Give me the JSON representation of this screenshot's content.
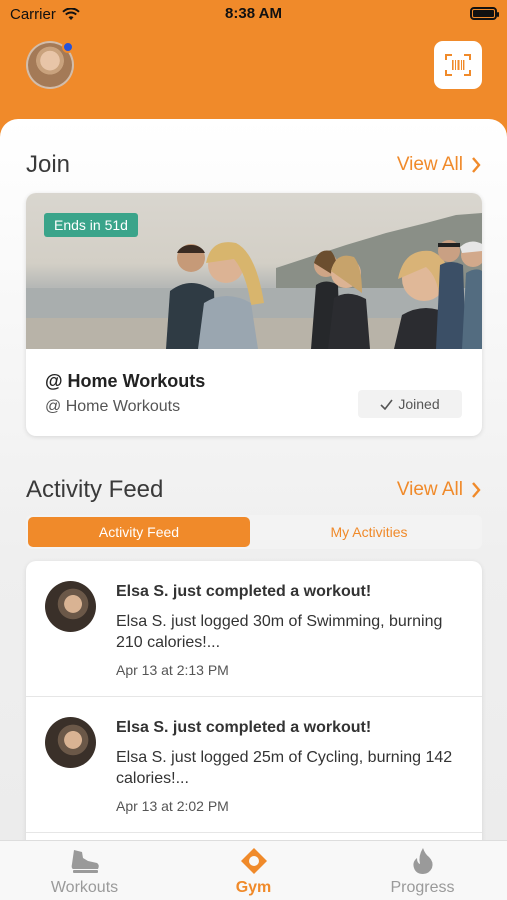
{
  "status_bar": {
    "carrier": "Carrier",
    "time": "8:38 AM"
  },
  "header": {
    "avatar_icon": "profile-avatar",
    "scan_icon": "barcode-scan-icon"
  },
  "join": {
    "title": "Join",
    "view_all": "View All",
    "card": {
      "badge": "Ends in 51d",
      "name": "@ Home Workouts",
      "subtitle": "@ Home Workouts",
      "joined_label": "Joined"
    }
  },
  "activity": {
    "title": "Activity Feed",
    "view_all": "View All",
    "tabs": [
      {
        "label": "Activity Feed",
        "active": true
      },
      {
        "label": "My Activities",
        "active": false
      }
    ],
    "items": [
      {
        "title": "Elsa S. just completed a workout!",
        "text": "Elsa S. just logged 30m of Swimming, burning 210 calories!...",
        "time": "Apr 13 at 2:13 PM"
      },
      {
        "title": "Elsa S. just completed a workout!",
        "text": "Elsa S. just logged 25m of Cycling, burning 142 calories!...",
        "time": "Apr 13 at 2:02 PM"
      }
    ]
  },
  "nav": {
    "items": [
      {
        "label": "Workouts",
        "icon": "sneaker-icon",
        "active": false
      },
      {
        "label": "Gym",
        "icon": "location-pin-icon",
        "active": true
      },
      {
        "label": "Progress",
        "icon": "flame-icon",
        "active": false
      }
    ]
  },
  "colors": {
    "accent": "#f08a2a",
    "badge": "#3aa48a",
    "dot": "#2753d9"
  }
}
